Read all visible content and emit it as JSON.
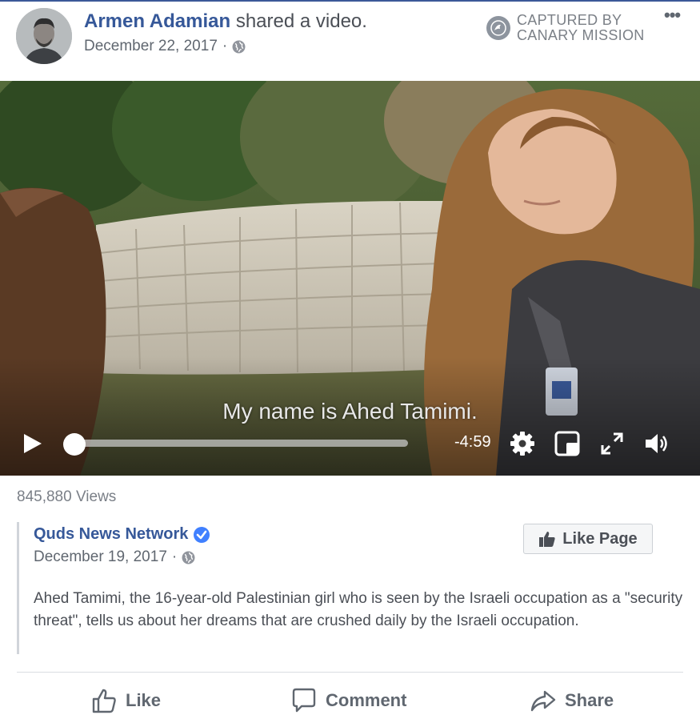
{
  "post": {
    "author": "Armen Adamian",
    "action": "shared a video.",
    "date": "December 22, 2017",
    "date_separator": "·",
    "privacy_icon": "globe-icon",
    "watermark": "CAPTURED BY\nCANARY MISSION",
    "more_icon": "more-options-icon",
    "more_glyph": "•••"
  },
  "video": {
    "subtitle": "My name is Ahed Tamimi.",
    "time_remaining": "-4:59",
    "progress": 0.0,
    "controls": [
      "play-icon",
      "settings-icon",
      "picture-in-picture-icon",
      "fullscreen-icon",
      "volume-icon"
    ]
  },
  "views": "845,880 Views",
  "shared": {
    "page_name": "Quds News Network",
    "verified_icon": "verified-badge-icon",
    "date": "December 19, 2017",
    "date_separator": "·",
    "like_page_label": "Like Page",
    "description": "Ahed Tamimi, the 16-year-old Palestinian girl who is seen by the Israeli occupation as a \"security threat\", tells us about her dreams that are crushed daily by the Israeli occupation."
  },
  "actions": {
    "like": "Like",
    "comment": "Comment",
    "share": "Share"
  },
  "colors": {
    "link_blue": "#365899",
    "verified_blue": "#4080ff",
    "text_gray": "#606770"
  }
}
